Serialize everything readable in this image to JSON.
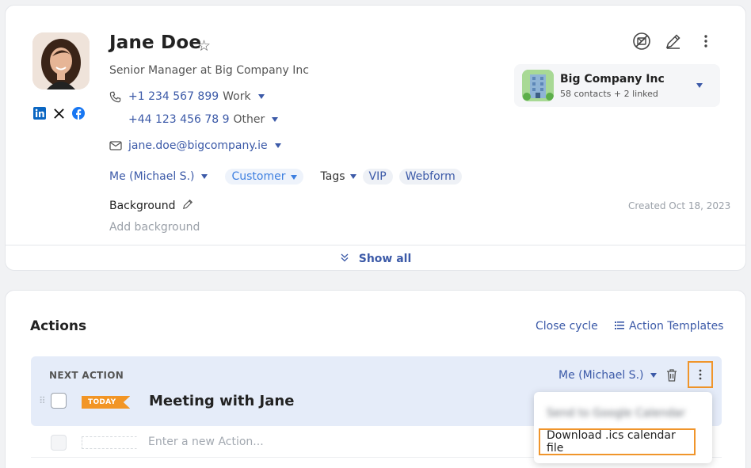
{
  "contact": {
    "name": "Jane Doe",
    "title": "Senior Manager at Big Company Inc",
    "phones": [
      {
        "number": "+1 234 567 899",
        "type": "Work"
      },
      {
        "number": "+44 123 456 78 9",
        "type": "Other"
      }
    ],
    "email": "jane.doe@bigcompany.ie",
    "owner": "Me (Michael S.)",
    "status": "Customer",
    "tags_label": "Tags",
    "tags": [
      "VIP",
      "Webform"
    ],
    "background_label": "Background",
    "background_placeholder": "Add background",
    "created": "Created Oct 18, 2023",
    "show_all": "Show all"
  },
  "company": {
    "name": "Big Company Inc",
    "meta": "58 contacts + 2 linked"
  },
  "actions": {
    "heading": "Actions",
    "close_cycle": "Close cycle",
    "templates": "Action Templates",
    "next_action_label": "NEXT ACTION",
    "next_owner": "Me (Michael S.)",
    "today_badge": "TODAY",
    "task_title": "Meeting with Jane",
    "new_placeholder": "Enter a new Action..."
  },
  "menu": {
    "items": [
      "Send to Google Calendar",
      "Download .ics calendar file"
    ]
  },
  "colors": {
    "accent": "#3c5aa8",
    "highlight": "#f0952b",
    "today": "#f29525",
    "panel": "#e5ecf9"
  }
}
